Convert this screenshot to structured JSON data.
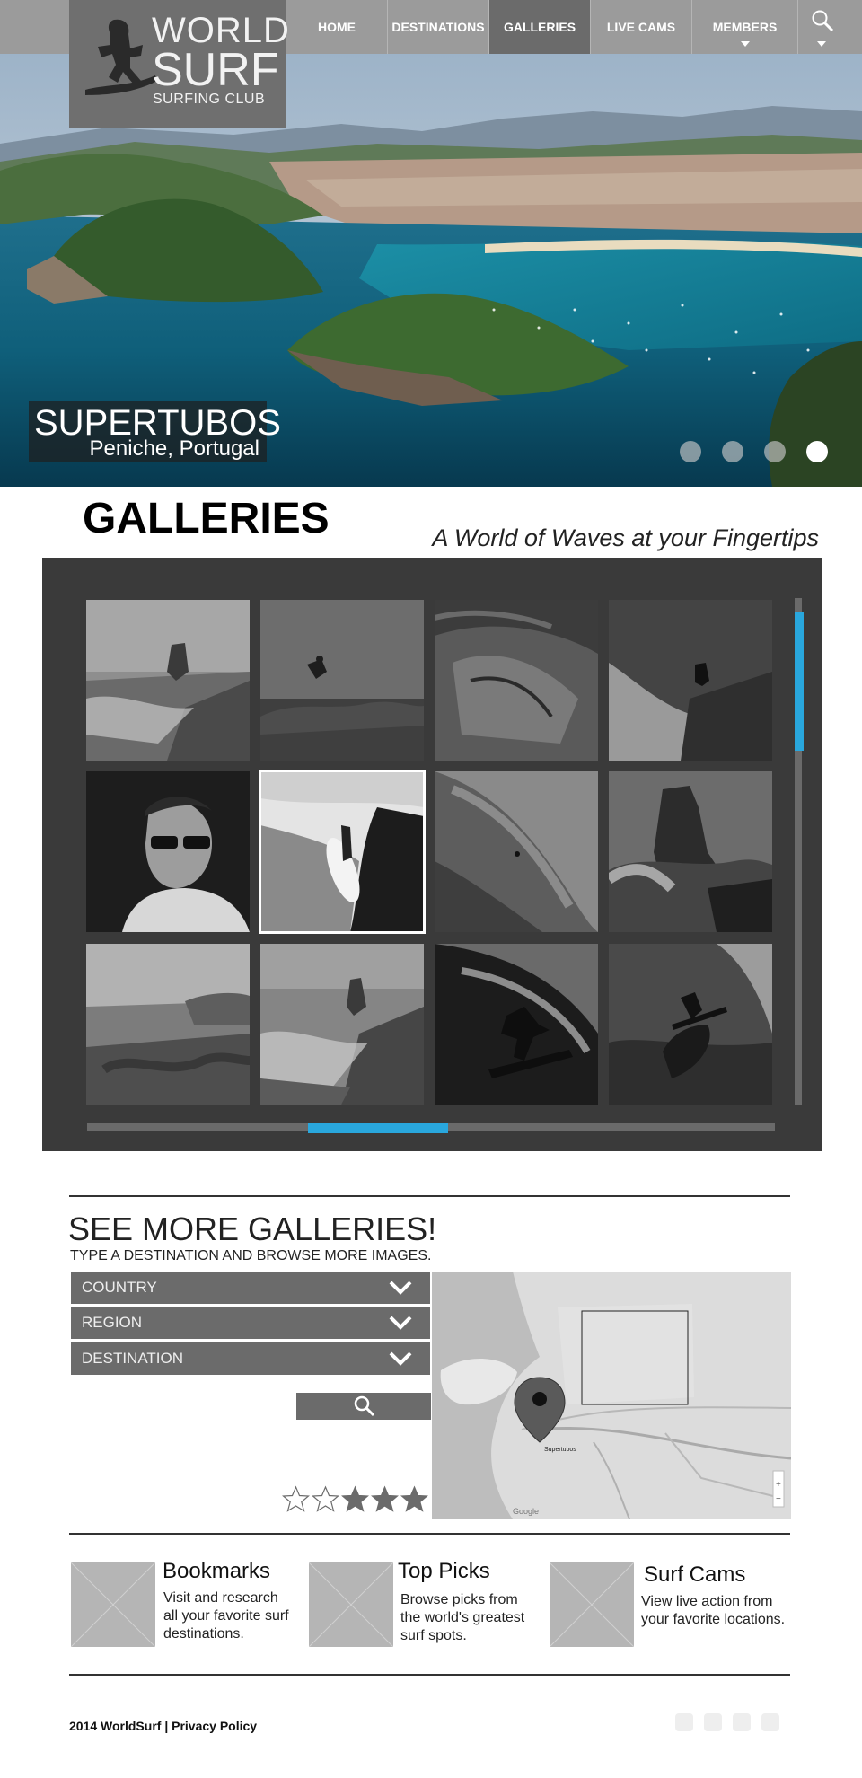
{
  "brand": {
    "line1": "WORLD",
    "line2": "SURF",
    "line3": "SURFING CLUB"
  },
  "nav": {
    "items": [
      {
        "label": "HOME",
        "active": false,
        "has_dropdown": false
      },
      {
        "label": "DESTINATIONS",
        "active": false,
        "has_dropdown": false
      },
      {
        "label": "GALLERIES",
        "active": true,
        "has_dropdown": false
      },
      {
        "label": "LIVE CAMS",
        "active": false,
        "has_dropdown": false
      },
      {
        "label": "MEMBERS",
        "active": false,
        "has_dropdown": true
      }
    ],
    "search_icon": "search-icon"
  },
  "hero": {
    "title": "SUPERTUBOS",
    "location": "Peniche, Portugal",
    "slides_count": 4,
    "active_slide": 4
  },
  "galleries": {
    "title": "GALLERIES",
    "tagline": "A World of  Waves at your Fingertips",
    "selected_index": 5,
    "thumbnails": [
      "rock-waves-icon",
      "surfer-air-icon",
      "rock-formation-icon",
      "surfer-spray-icon",
      "portrait-icon",
      "surfer-shore-icon",
      "big-wave-icon",
      "sea-stack-icon",
      "coastline-icon",
      "rocky-surf-icon",
      "tube-rider-icon",
      "aerial-surfer-icon"
    ]
  },
  "more": {
    "title": "SEE MORE GALLERIES!",
    "subtitle": "TYPE A DESTINATION AND BROWSE MORE IMAGES.",
    "country": "COUNTRY",
    "region": "REGION",
    "destination": "DESTINATION",
    "rating": 3,
    "rating_max": 5,
    "map": {
      "pin_label": "Supertubos",
      "attribution": "Google"
    }
  },
  "features": [
    {
      "title": "Bookmarks",
      "desc": [
        "Visit and research",
        "all your favorite surf",
        "destinations."
      ]
    },
    {
      "title": "Top Picks",
      "desc": [
        "Browse picks from",
        "the world's greatest",
        "surf spots."
      ]
    },
    {
      "title": "Surf Cams",
      "desc": [
        "View live action from",
        "your favorite locations."
      ]
    }
  ],
  "footer": {
    "text": "2014 WorldSurf | Privacy Policy"
  },
  "colors": {
    "accent": "#29a7dd",
    "nav_bg": "#9b9b9b",
    "panel_bg": "#3a3a3a",
    "control_bg": "#6b6b6b"
  }
}
